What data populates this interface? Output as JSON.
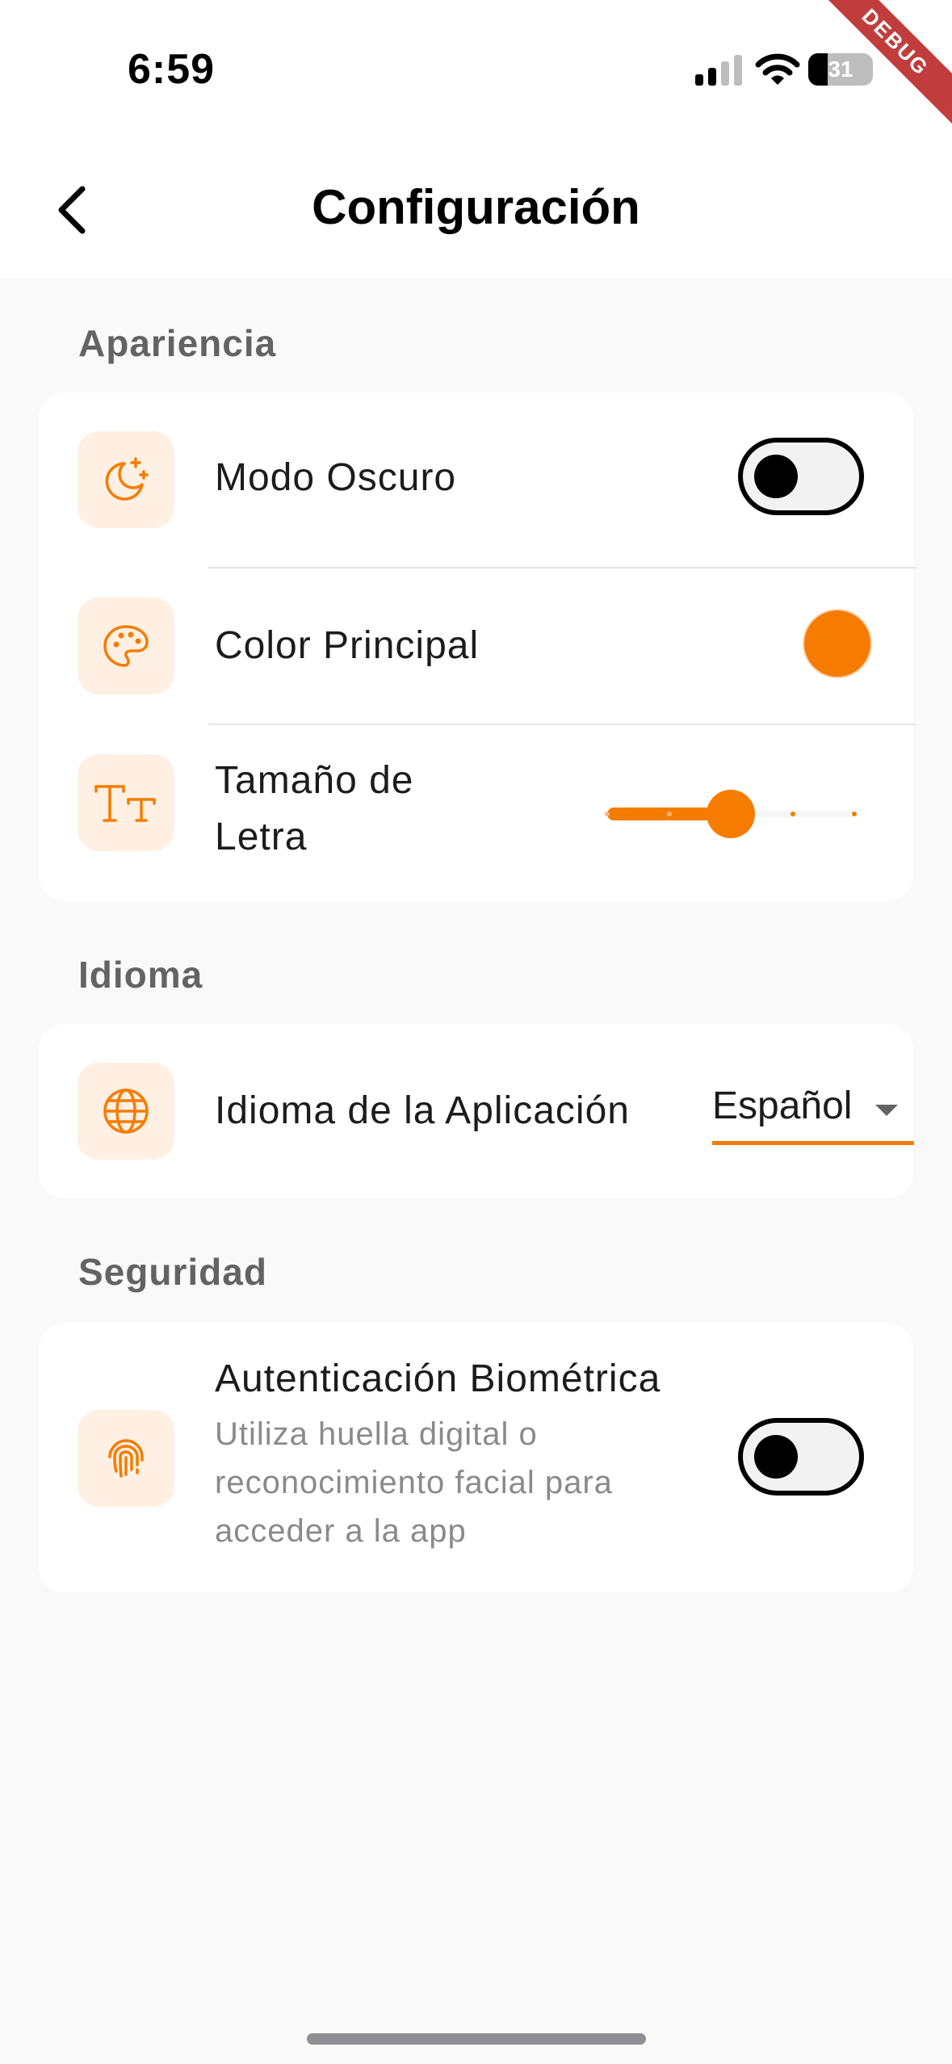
{
  "status_bar": {
    "time": "6:59",
    "battery": "31",
    "debug_label": "DEBUG"
  },
  "header": {
    "title": "Configuración",
    "back_icon": "chevron-left-icon"
  },
  "accent_color": "#f57c00",
  "sections": {
    "appearance": {
      "title": "Apariencia",
      "dark_mode": {
        "label": "Modo Oscuro",
        "icon": "moon-stars-icon",
        "enabled": false
      },
      "primary_color": {
        "label": "Color Principal",
        "icon": "palette-icon",
        "value": "#f57c00"
      },
      "font_size": {
        "label_line1": "Tamaño de",
        "label_line2": "Letra",
        "icon": "text-size-icon",
        "level_fraction": 0.5,
        "steps": 5
      }
    },
    "language": {
      "title": "Idioma",
      "app_language": {
        "label": "Idioma de la Aplicación",
        "icon": "globe-icon",
        "selected": "Español"
      }
    },
    "security": {
      "title": "Seguridad",
      "biometric": {
        "label": "Autenticación Biométrica",
        "icon": "fingerprint-icon",
        "description_lines": [
          "Utiliza huella digital o",
          "reconocimiento facial para",
          "acceder a la app"
        ],
        "enabled": false
      }
    }
  }
}
